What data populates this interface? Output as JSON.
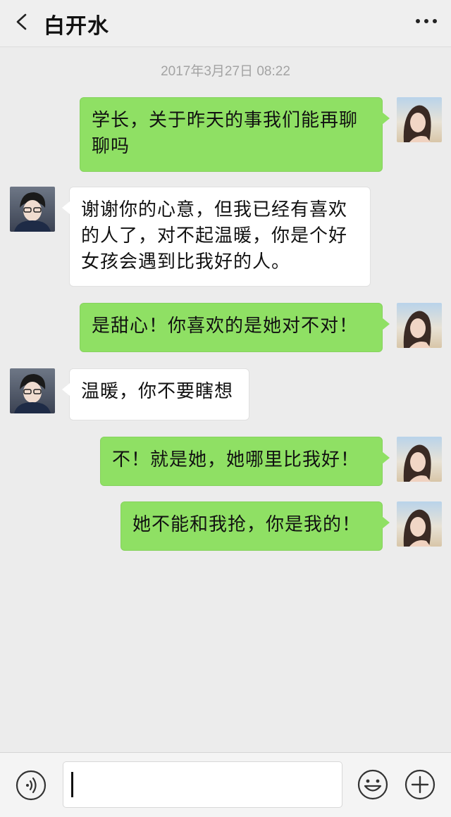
{
  "header": {
    "title": "白开水",
    "back_icon": "chevron-left-icon",
    "more_icon": "more-dots-icon"
  },
  "timestamp": "2017年3月27日  08:22",
  "messages": [
    {
      "sender": "me",
      "text": "学长，关于昨天的事我们能再聊聊吗"
    },
    {
      "sender": "peer",
      "text": "谢谢你的心意，但我已经有喜欢的人了，对不起温暖，你是个好女孩会遇到比我好的人。"
    },
    {
      "sender": "me",
      "text": "是甜心！你喜欢的是她对不对！"
    },
    {
      "sender": "peer",
      "text": "温暖，你不要瞎想"
    },
    {
      "sender": "me",
      "text": "不！就是她，她哪里比我好！"
    },
    {
      "sender": "me",
      "text": "她不能和我抢，你是我的！"
    }
  ],
  "footer": {
    "voice_icon": "voice-icon",
    "emoji_icon": "emoji-icon",
    "plus_icon": "plus-icon",
    "input_value": ""
  },
  "colors": {
    "me_bubble": "#8fe064",
    "peer_bubble": "#ffffff",
    "background": "#ececec"
  }
}
